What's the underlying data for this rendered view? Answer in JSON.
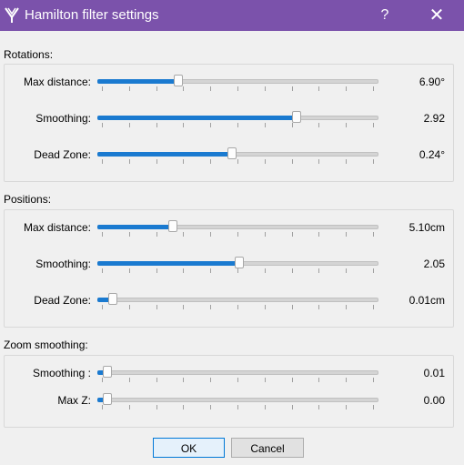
{
  "window": {
    "title": "Hamilton filter settings",
    "help": "?",
    "close": "✕",
    "app_icon": "hamilton-logo-icon"
  },
  "rotations": {
    "label": "Rotations:",
    "rows": [
      {
        "label": "Max distance:",
        "value": "6.90°",
        "fraction": 0.28
      },
      {
        "label": "Smoothing:",
        "value": "2.92",
        "fraction": 0.715
      },
      {
        "label": "Dead Zone:",
        "value": "0.24°",
        "fraction": 0.478
      }
    ]
  },
  "positions": {
    "label": "Positions:",
    "rows": [
      {
        "label": "Max distance:",
        "value": "5.10cm",
        "fraction": 0.26
      },
      {
        "label": "Smoothing:",
        "value": "2.05",
        "fraction": 0.505
      },
      {
        "label": "Dead Zone:",
        "value": "0.01cm",
        "fraction": 0.04
      }
    ]
  },
  "zoom": {
    "label": "Zoom smoothing:",
    "rows": [
      {
        "label": "Smoothing :",
        "value": "0.01",
        "fraction": 0.02
      },
      {
        "label": "Max Z:",
        "value": "0.00",
        "fraction": 0.02
      }
    ]
  },
  "buttons": {
    "ok": "OK",
    "cancel": "Cancel"
  },
  "colors": {
    "titlebar": "#7b52ab",
    "slider_fill": "#1a7ad0"
  }
}
